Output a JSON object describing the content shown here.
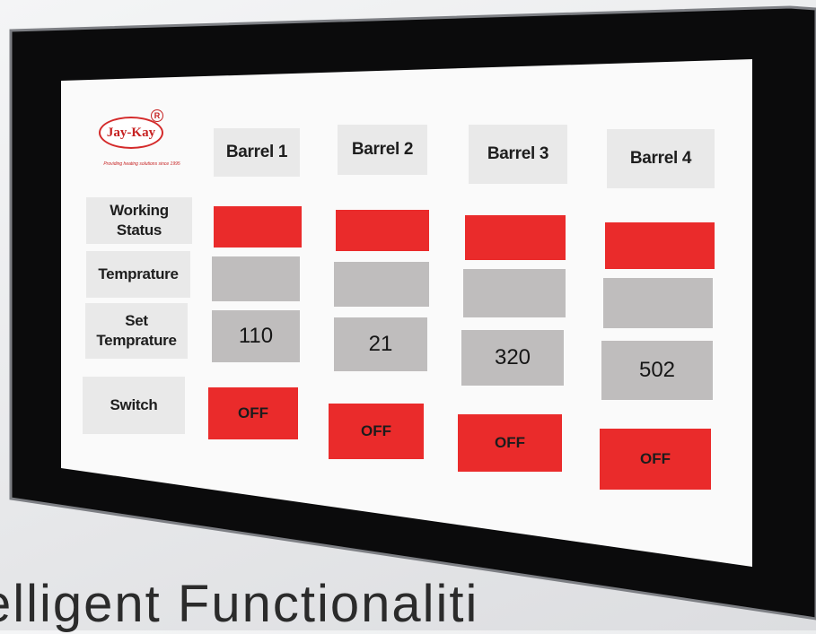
{
  "brand": {
    "name": "Jay-Kay",
    "registered_mark": "R",
    "tagline": "Providing heating solutions since 1995"
  },
  "barrels": [
    {
      "header": "Barrel 1",
      "set_temperature": "110",
      "switch_label": "OFF"
    },
    {
      "header": "Barrel 2",
      "set_temperature": "21",
      "switch_label": "OFF"
    },
    {
      "header": "Barrel 3",
      "set_temperature": "320",
      "switch_label": "OFF"
    },
    {
      "header": "Barrel 4",
      "set_temperature": "502",
      "switch_label": "OFF"
    }
  ],
  "row_labels": {
    "working_status": "Working Status",
    "temperature": "Temprature",
    "set_temperature_line1": "Set",
    "set_temperature_line2": "Temprature",
    "switch": "Switch"
  },
  "caption": "elligent Functionaliti",
  "colors": {
    "status_red": "#ea2b2b",
    "value_gray": "#bfbdbd",
    "label_bg": "#e9e9e9",
    "bezel": "#0b0b0c"
  }
}
